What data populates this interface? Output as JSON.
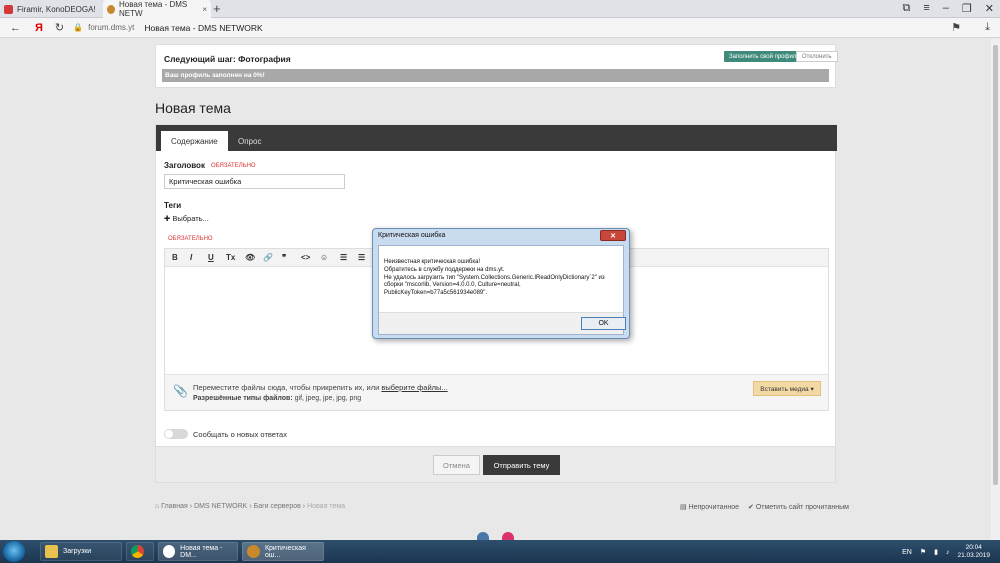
{
  "browser": {
    "tabs": [
      {
        "label": "Firamir, KonoDEOGA!"
      },
      {
        "label": "Новая тема - DMS NETW",
        "close": "×"
      }
    ],
    "new_tab": "+",
    "url": "forum.dms.yt",
    "page_title": "Новая тема - DMS NETWORK",
    "nav_icons": [
      "back-arrow-icon",
      "yandex-icon",
      "reload-icon",
      "lock-icon",
      "bookmark-icon",
      "download-icon"
    ]
  },
  "step": {
    "title": "Следующий шаг: Фотография",
    "fill_button": "Заполнить свой профиль",
    "dismiss_button": "Отклонить",
    "progress_text": "Ваш профиль заполнен на 0%!",
    "progress_value": 0
  },
  "page": {
    "heading": "Новая тема"
  },
  "form": {
    "tabs": [
      "Содержание",
      "Опрос"
    ],
    "title_label": "Заголовок",
    "required": "ОБЯЗАТЕЛЬНО",
    "title_value": "Критическая ошибка",
    "tags_label": "Теги",
    "tags_choose": "✚ Выбрать...",
    "tags_required": "ОБЯЗАТЕЛЬНО",
    "toolbar": [
      "B",
      "I",
      "U",
      "Tx",
      "👁",
      "🔗",
      "❞",
      "<>",
      "☺",
      "☰",
      "☰"
    ],
    "attach_text": "Переместите файлы сюда, чтобы прикрепить их, или",
    "attach_link": "выберите файлы...",
    "attach_types_label": "Разрешённые типы файлов:",
    "attach_types": "gif, jpeg, jpe, jpg, png",
    "insert_media": "Вставить медиа ▾",
    "watch_label": "Сообщать о новых ответах",
    "cancel": "Отмена",
    "submit": "Отправить тему"
  },
  "breadcrumb": {
    "items": [
      "⌂ Главная",
      "DMS NETWORK",
      "Баги серверов",
      "Новая тема"
    ],
    "separator": "›"
  },
  "footer_links": [
    "Непрочитанное",
    "Отметить сайт прочитанным"
  ],
  "dialog": {
    "title": "Критическая ошибка",
    "close": "✕",
    "lines": [
      "Неизвестная критическая ошибка!",
      "Обратитесь в службу поддержки на dms.yt.",
      "Не удалось загрузить тип \"System.Collections.Generic.IReadOnlyDictionary`2\" из",
      "сборки \"mscorlib, Version=4.0.0.0, Culture=neutral,",
      "PublicKeyToken=b77a5c561934e089\"."
    ],
    "ok": "OK"
  },
  "taskbar": {
    "items": [
      "Загрузки",
      "",
      "Новая тема - DM...",
      "Критическая ош..."
    ],
    "lang": "EN",
    "time": "20:04",
    "date": "21.03.2019"
  },
  "colors": {
    "accent": "#3f8a7a",
    "dark": "#3a3a3a",
    "required": "#dd3333",
    "media_button": "#f3d9a4"
  }
}
